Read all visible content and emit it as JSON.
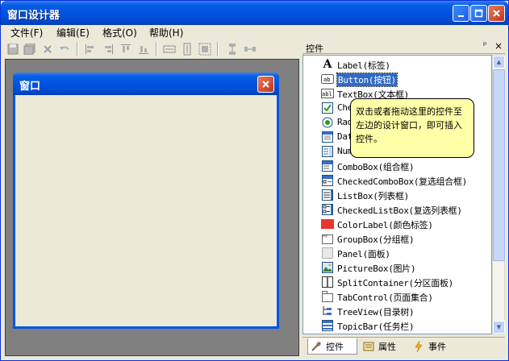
{
  "window": {
    "title": "窗口设计器"
  },
  "menu": [
    "文件(F)",
    "编辑(E)",
    "格式(O)",
    "帮助(H)"
  ],
  "form": {
    "title": "窗口"
  },
  "toolbox": {
    "title": "控件",
    "pin_glyph": "ᵖ",
    "close_glyph": "×",
    "items": [
      {
        "label": "Label(标签)",
        "icon": "label-icon"
      },
      {
        "label": "Button(按钮)",
        "icon": "button-icon",
        "selected": true
      },
      {
        "label": "TextBox(文本框)",
        "icon": "textbox-icon"
      },
      {
        "label": "CheckBox",
        "icon": "checkbox-icon"
      },
      {
        "label": "RadioButton",
        "icon": "radio-icon"
      },
      {
        "label": "DateTimePicker",
        "icon": "datetime-icon"
      },
      {
        "label": "NumericUpDown",
        "icon": "numeric-icon"
      },
      {
        "label": "ComboBox(组合框)",
        "icon": "combobox-icon"
      },
      {
        "label": "CheckedComboBox(复选组合框)",
        "icon": "checkedcombobox-icon"
      },
      {
        "label": "ListBox(列表框)",
        "icon": "listbox-icon"
      },
      {
        "label": "CheckedListBox(复选列表框)",
        "icon": "checkedlistbox-icon"
      },
      {
        "label": "ColorLabel(颜色标签)",
        "icon": "colorlabel-icon"
      },
      {
        "label": "GroupBox(分组框)",
        "icon": "groupbox-icon"
      },
      {
        "label": "Panel(面板)",
        "icon": "panel-icon"
      },
      {
        "label": "PictureBox(图片)",
        "icon": "picturebox-icon"
      },
      {
        "label": "SplitContainer(分区面板)",
        "icon": "splitcontainer-icon"
      },
      {
        "label": "TabControl(页面集合)",
        "icon": "tabcontrol-icon"
      },
      {
        "label": "TreeView(目录树)",
        "icon": "treeview-icon"
      },
      {
        "label": "TopicBar(任务栏)",
        "icon": "topicbar-icon"
      }
    ],
    "tabs": [
      "控件",
      "属性",
      "事件"
    ]
  },
  "tooltip": {
    "text": "双击或者拖动这里的控件至左边的设计窗口，即可插入控件。"
  },
  "colors": {
    "title_blue": "#0054e3",
    "selected": "#316ac5",
    "tooltip_bg": "#ffffa8",
    "colorlabel_red": "#e8362c"
  }
}
